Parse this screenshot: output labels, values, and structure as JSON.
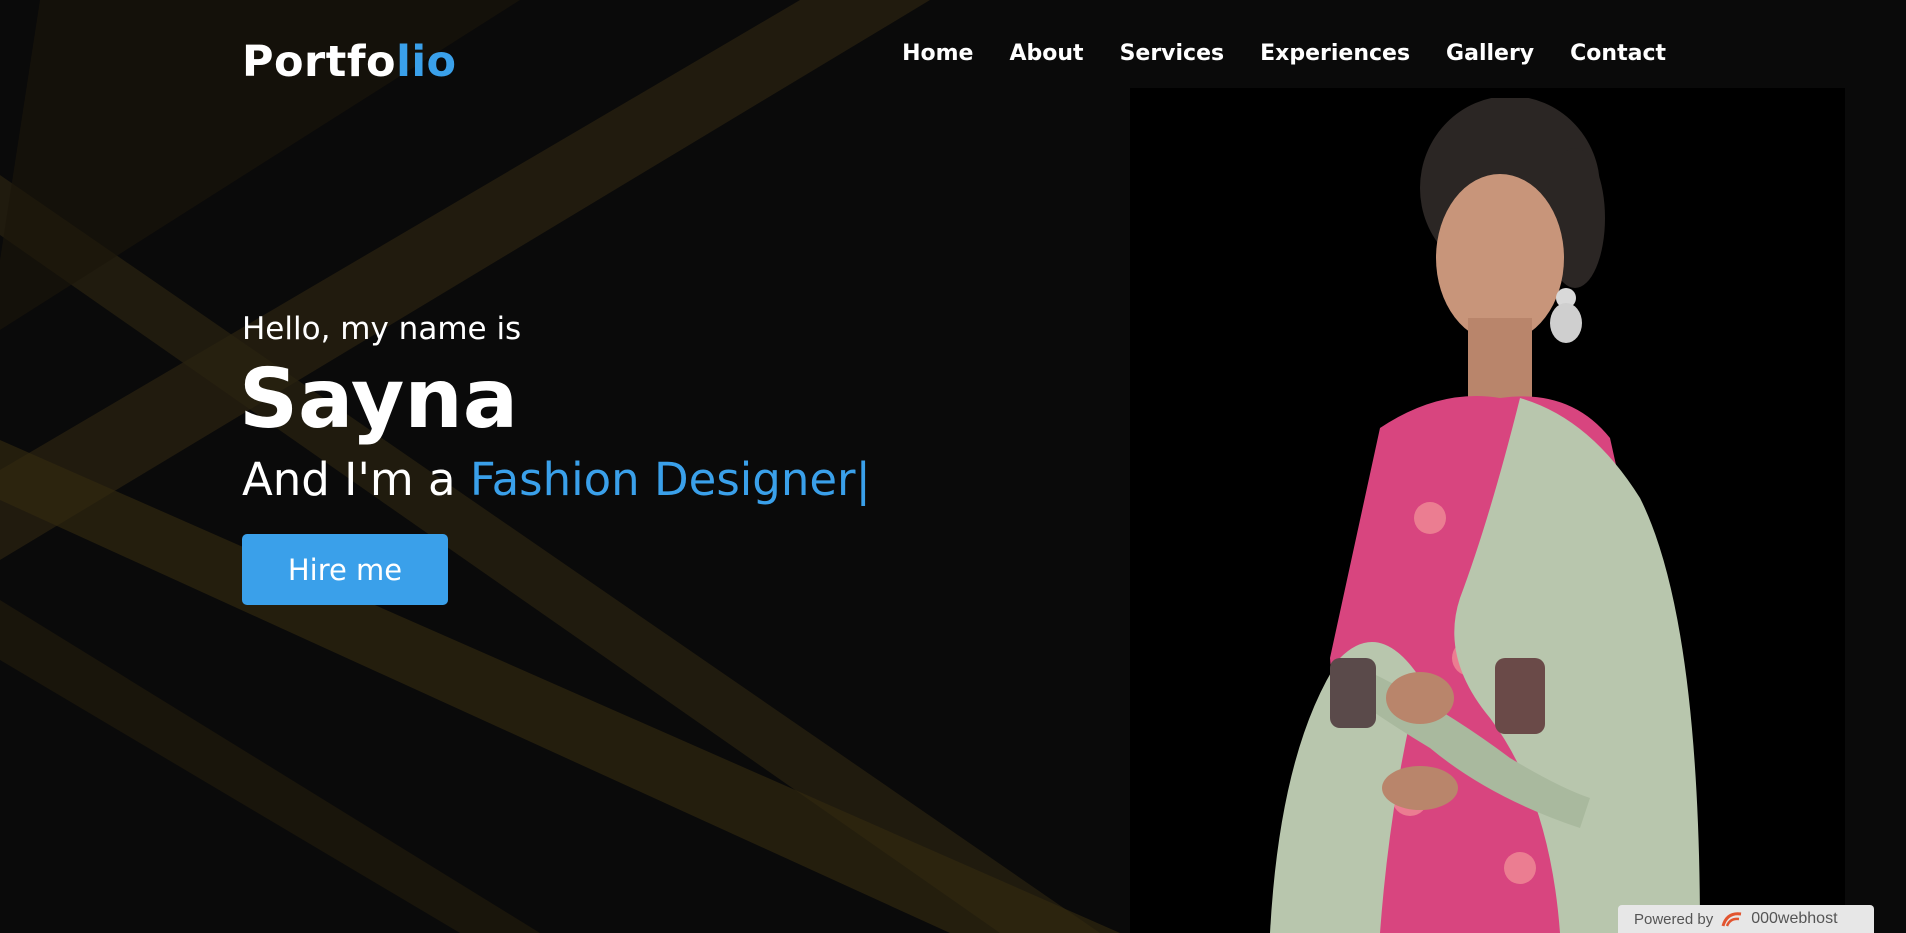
{
  "logo": {
    "main": "Portfo",
    "accent": "lio"
  },
  "nav": {
    "items": [
      {
        "label": "Home"
      },
      {
        "label": "About"
      },
      {
        "label": "Services"
      },
      {
        "label": "Experiences"
      },
      {
        "label": "Gallery"
      },
      {
        "label": "Contact"
      }
    ]
  },
  "hero": {
    "greeting": "Hello, my name is",
    "name": "Sayna",
    "profession_prefix": "And I'm a ",
    "profession": "Fashion Designer",
    "caret": "|",
    "cta_label": "Hire me"
  },
  "badge": {
    "powered_label": "Powered by",
    "brand_label": "000webhost"
  },
  "colors": {
    "accent": "#3aa0ea",
    "background": "#0a0a0a",
    "beam": "#3a2d10"
  }
}
